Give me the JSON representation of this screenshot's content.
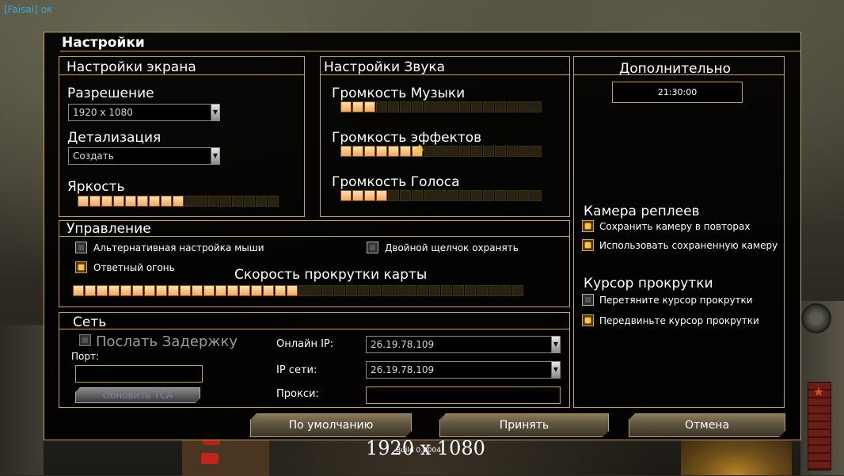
{
  "player_tag": "[Faisal] ок",
  "dialog_title": "Настройки",
  "screen": {
    "title": "Настройки экрана",
    "resolution_label": "Разрешение",
    "resolution_value": "1920 x 1080",
    "detail_label": "Детализация",
    "detail_value": "Создать",
    "brightness_label": "Яркость",
    "brightness_level": 9,
    "brightness_total": 17
  },
  "sound": {
    "title": "Настройки Звука",
    "music_label": "Громкость Музыки",
    "music_level": 3,
    "effects_label": "Громкость эффектов",
    "effects_level": 7,
    "voice_label": "Громкость Голоса",
    "voice_level": 4,
    "total": 17
  },
  "extra": {
    "title": "Дополнительно",
    "time": "21:30:00",
    "replay_camera_title": "Камера реплеев",
    "save_camera_label": "Сохранить камеру в повторах",
    "save_camera_checked": true,
    "use_saved_camera_label": "Использовать сохраненную камеру",
    "use_saved_camera_checked": true,
    "scroll_cursor_title": "Курсор прокрутки",
    "drag_cursor_label": "Перетяните курсор прокрутки",
    "drag_cursor_checked": false,
    "move_cursor_label": "Передвиньте курсор прокрутки",
    "move_cursor_checked": true
  },
  "control": {
    "title": "Управление",
    "alt_mouse_label": "Альтернативная настройка мыши",
    "alt_mouse_checked": false,
    "double_click_label": "Двойной щелчок охранять",
    "double_click_checked": false,
    "return_fire_label": "Ответный огонь",
    "return_fire_checked": true,
    "scroll_speed_label": "Скорость прокрутки карты",
    "scroll_speed_level": 19,
    "scroll_speed_total": 38
  },
  "network": {
    "title": "Сеть",
    "send_delay_label": "Послать Задержку",
    "port_label": "Порт:",
    "port_value": "",
    "update_tca_label": "Обновить ТСА",
    "online_ip_label": "Онлайн IP:",
    "online_ip_value": "26.19.78.109",
    "net_ip_label": "IP сети:",
    "net_ip_value": "26.19.78.109",
    "proxy_label": "Прокси:",
    "proxy_value": ""
  },
  "buttons": {
    "default_label": "По умолчанию",
    "accept_label": "Принять",
    "cancel_label": "Отмена"
  },
  "overlay": {
    "resolution_text": "1920 x 1080",
    "small_text": "Build 0.0004"
  },
  "colors": {
    "frame_gold": "#c8a23c",
    "segment_on": "#f0a860",
    "checkbox_on": "#f5c542",
    "player_tag": "#3fa7d9"
  }
}
